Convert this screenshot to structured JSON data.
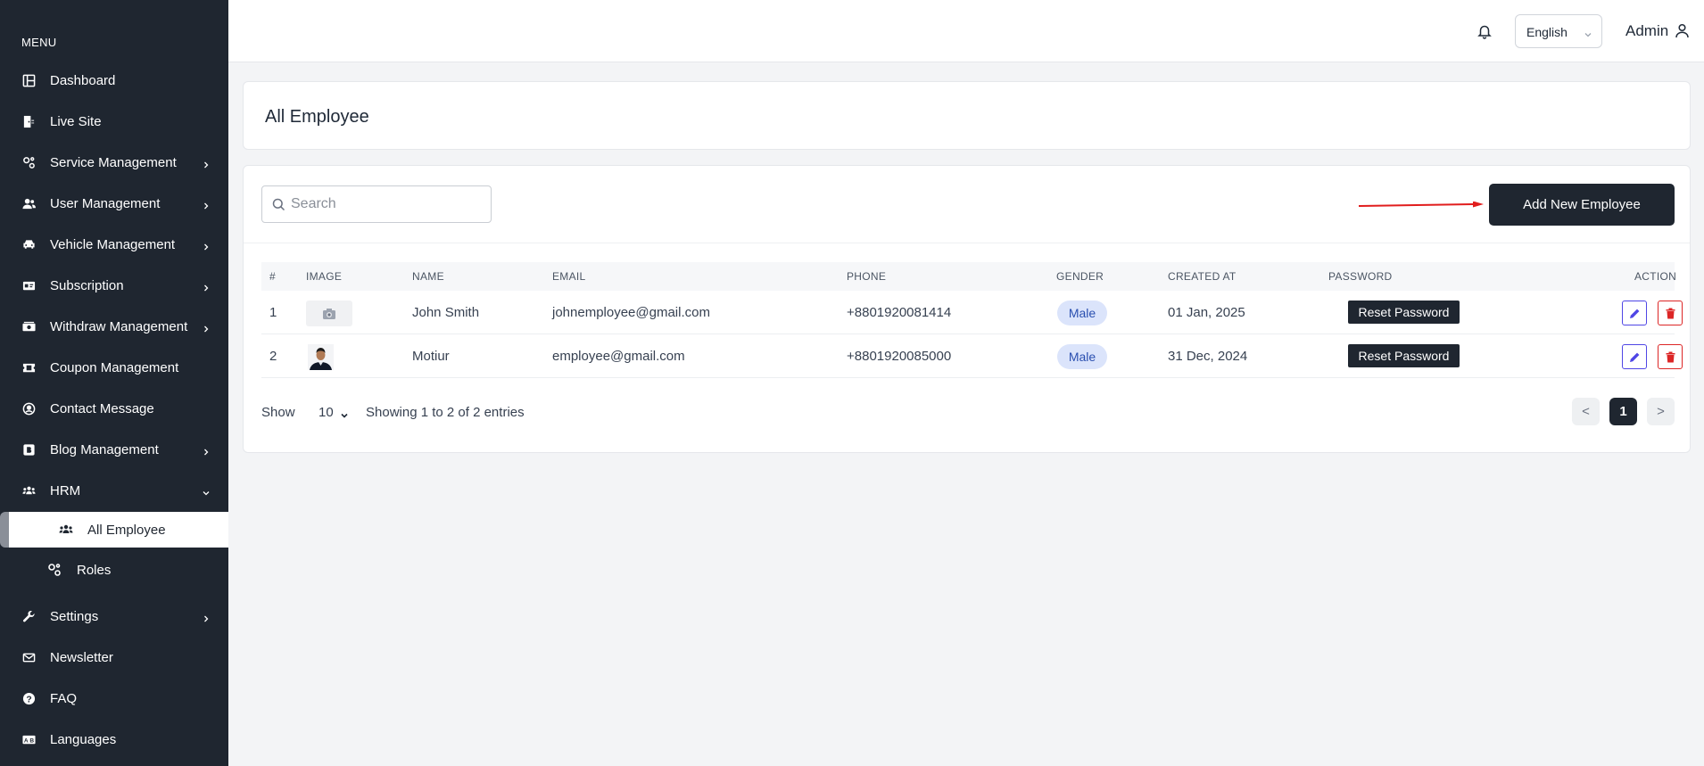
{
  "sidebar": {
    "menu_label": "MENU",
    "items": [
      {
        "label": "Dashboard",
        "icon": "dashboard-icon",
        "expandable": false
      },
      {
        "label": "Live Site",
        "icon": "door-exit-icon",
        "expandable": false
      },
      {
        "label": "Service Management",
        "icon": "gears-icon",
        "expandable": true
      },
      {
        "label": "User Management",
        "icon": "users-icon",
        "expandable": true
      },
      {
        "label": "Vehicle Management",
        "icon": "car-icon",
        "expandable": true
      },
      {
        "label": "Subscription",
        "icon": "id-card-icon",
        "expandable": true
      },
      {
        "label": "Withdraw Management",
        "icon": "money-bill-icon",
        "expandable": true
      },
      {
        "label": "Coupon Management",
        "icon": "ticket-icon",
        "expandable": false
      },
      {
        "label": "Contact Message",
        "icon": "contact-icon",
        "expandable": false
      },
      {
        "label": "Blog Management",
        "icon": "blog-icon",
        "expandable": true
      },
      {
        "label": "HRM",
        "icon": "people-group-icon",
        "expandable": true,
        "expanded": true
      },
      {
        "label": "Settings",
        "icon": "wrench-icon",
        "expandable": true
      },
      {
        "label": "Newsletter",
        "icon": "envelope-icon",
        "expandable": false
      },
      {
        "label": "FAQ",
        "icon": "question-circle-icon",
        "expandable": false
      },
      {
        "label": "Languages",
        "icon": "language-icon",
        "expandable": false
      }
    ],
    "hrm_sub": [
      {
        "label": "All Employee",
        "icon": "users-icon",
        "active": true
      },
      {
        "label": "Roles",
        "icon": "gears-icon",
        "active": false
      }
    ]
  },
  "header": {
    "language": "English",
    "user": "Admin"
  },
  "page": {
    "title": "All Employee"
  },
  "toolbar": {
    "search_placeholder": "Search",
    "add_button": "Add New Employee"
  },
  "table": {
    "columns": [
      "#",
      "IMAGE",
      "NAME",
      "EMAIL",
      "PHONE",
      "GENDER",
      "CREATED AT",
      "PASSWORD",
      "ACTION"
    ],
    "rows": [
      {
        "index": "1",
        "name": "John Smith",
        "email": "johnemployee@gmail.com",
        "phone": "+8801920081414",
        "gender": "Male",
        "created_at": "01 Jan, 2025",
        "password_action": "Reset Password",
        "image": "placeholder"
      },
      {
        "index": "2",
        "name": "Motiur",
        "email": "employee@gmail.com",
        "phone": "+8801920085000",
        "gender": "Male",
        "created_at": "31 Dec, 2024",
        "password_action": "Reset Password",
        "image": "photo"
      }
    ]
  },
  "pagination": {
    "show_label": "Show",
    "page_size": "10",
    "info": "Showing 1 to 2 of 2 entries",
    "prev": "<",
    "current": "1",
    "next": ">"
  },
  "colors": {
    "sidebar_bg": "#1f2630",
    "accent_dark": "#1f2630",
    "edit": "#4f46e5",
    "delete": "#dc2626",
    "annotation_arrow": "#e11d1d"
  }
}
